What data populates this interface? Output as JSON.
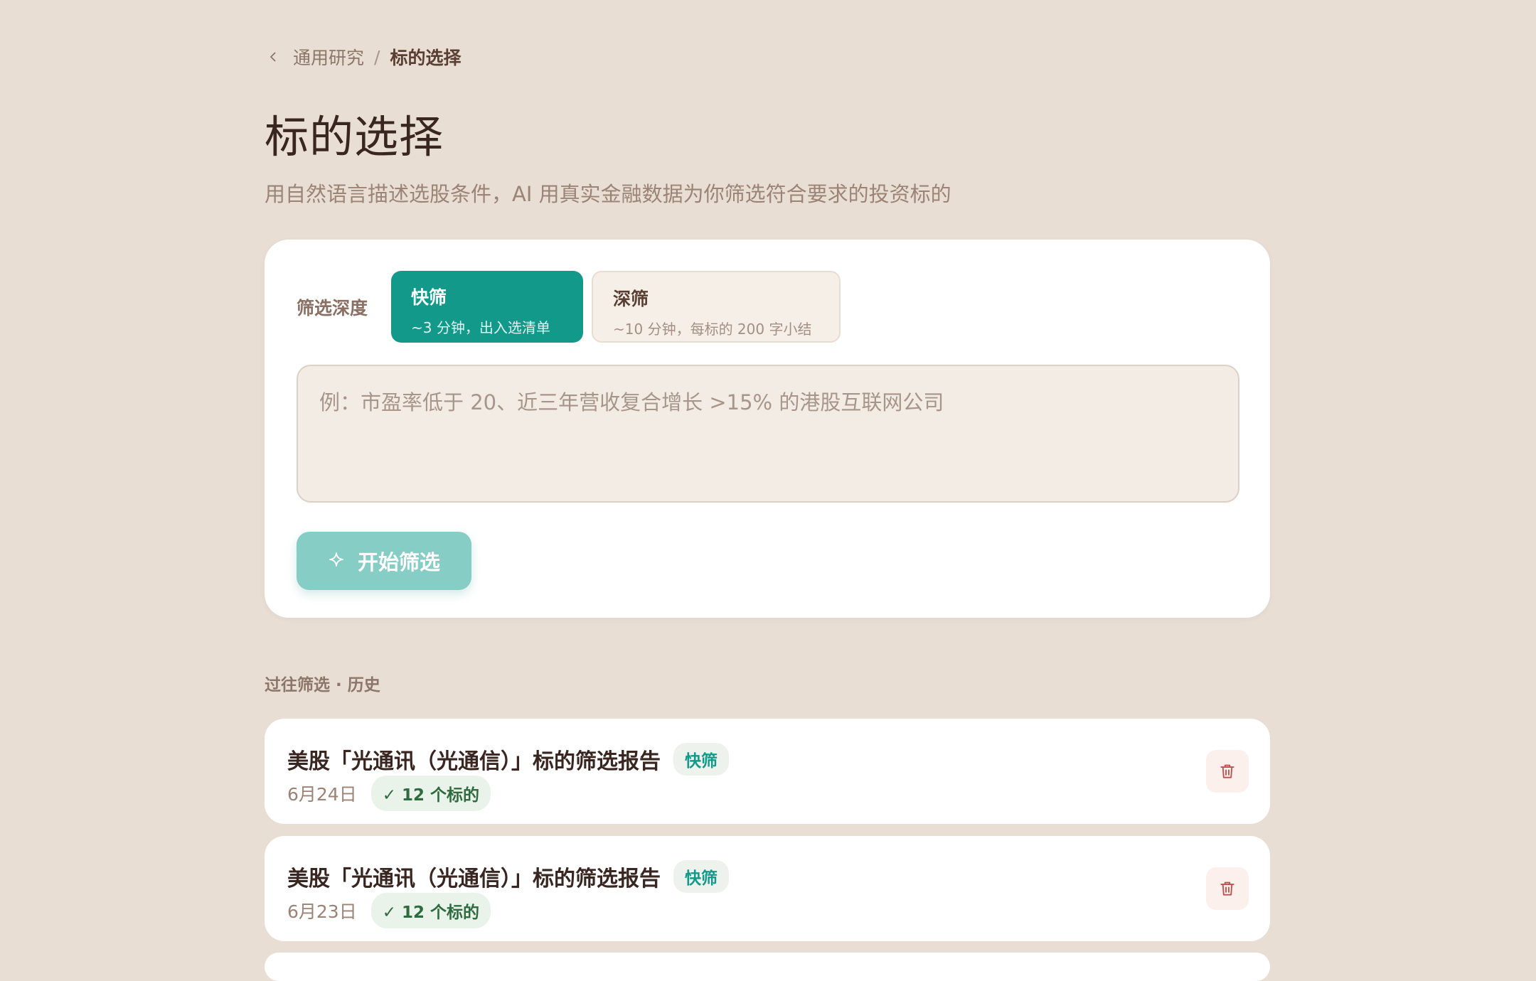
{
  "breadcrumb": {
    "parent": "通用研究",
    "separator": "/",
    "current": "标的选择"
  },
  "page": {
    "title": "标的选择",
    "subtitle": "用自然语言描述选股条件，AI 用真实金融数据为你筛选符合要求的投资标的"
  },
  "screen_form": {
    "depth_label": "筛选深度",
    "depth_options": [
      {
        "title": "快筛",
        "desc": "~3 分钟，出入选清单",
        "selected": true
      },
      {
        "title": "深筛",
        "desc": "~10 分钟，每标的 200 字小结",
        "selected": false
      }
    ],
    "query": {
      "value": "",
      "placeholder": "例：市盈率低于 20、近三年营收复合增长 >15% 的港股互联网公司"
    },
    "start_label": "开始筛选",
    "start_icon": "sparkle-icon"
  },
  "history": {
    "title": "过往筛选 · 历史",
    "items": [
      {
        "title": "美股「光通讯（光通信）」标的筛选报告",
        "badge": "快筛",
        "date": "6月24日",
        "count": "✓ 12 个标的"
      },
      {
        "title": "美股「光通讯（光通信）」标的筛选报告",
        "badge": "快筛",
        "date": "6月23日",
        "count": "✓ 12 个标的"
      }
    ]
  },
  "colors": {
    "background": "#e8ded4",
    "accent": "#13998a",
    "accent_disabled": "#86cdc5",
    "danger": "#c0504d"
  }
}
